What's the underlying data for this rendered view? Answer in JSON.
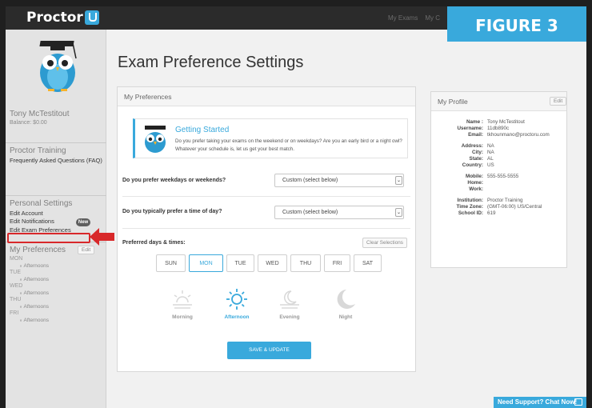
{
  "header": {
    "logo_text": "Proctor",
    "nav": [
      "My Exams",
      "My C"
    ]
  },
  "figure_label": "FIGURE 3",
  "user": {
    "name": "Tony McTestitout",
    "balance": "Balance: $0.00"
  },
  "sidebar": {
    "training": {
      "heading": "Proctor Training",
      "faq": "Frequently Asked Questions (FAQ)"
    },
    "settings": {
      "heading": "Personal Settings",
      "edit_account": "Edit Account",
      "edit_notifications": "Edit Notifications",
      "new_badge": "New",
      "edit_exam_prefs": "Edit Exam Preferences"
    },
    "my_prefs": {
      "heading": "My Preferences",
      "edit": "Edit",
      "items": [
        {
          "day": "MON",
          "time": "Afternoons"
        },
        {
          "day": "TUE",
          "time": "Afternoons"
        },
        {
          "day": "WED",
          "time": "Afternoons"
        },
        {
          "day": "THU",
          "time": "Afternoons"
        },
        {
          "day": "FRI",
          "time": "Afternoons"
        }
      ]
    }
  },
  "page_title": "Exam Preference Settings",
  "prefs": {
    "panel_title": "My Preferences",
    "gs_title": "Getting Started",
    "gs_desc": "Do you prefer taking your exams on the weekend or on weekdays? Are you an early bird or a night owl? Whatever your schedule is, let us get your best match.",
    "q1": "Do you prefer weekdays or weekends?",
    "q1_value": "Custom (select below)",
    "q2": "Do you typically prefer a time of day?",
    "q2_value": "Custom (select below)",
    "pref_label": "Preferred days & times:",
    "clear": "Clear Selections",
    "days": [
      "SUN",
      "MON",
      "TUE",
      "WED",
      "THU",
      "FRI",
      "SAT"
    ],
    "selected_day": "MON",
    "times": [
      "Morning",
      "Afternoon",
      "Evening",
      "Night"
    ],
    "selected_time": "Afternoon",
    "save": "SAVE & UPDATE"
  },
  "profile": {
    "title": "My Profile",
    "edit": "Edit",
    "rows": [
      {
        "k": "Name :",
        "v": "Tony McTestitout"
      },
      {
        "k": "Username:",
        "v": "11db890c"
      },
      {
        "k": "Email:",
        "v": "tkhounmano@proctoru.com"
      },
      {
        "k": "",
        "v": ""
      },
      {
        "k": "Address:",
        "v": "NA"
      },
      {
        "k": "City:",
        "v": "NA"
      },
      {
        "k": "State:",
        "v": "AL"
      },
      {
        "k": "Country:",
        "v": "US"
      },
      {
        "k": "",
        "v": ""
      },
      {
        "k": "Mobile:",
        "v": "555-555-5555"
      },
      {
        "k": "Home:",
        "v": ""
      },
      {
        "k": "Work:",
        "v": ""
      },
      {
        "k": "",
        "v": ""
      },
      {
        "k": "Institution:",
        "v": "Proctor Training"
      },
      {
        "k": "Time Zone:",
        "v": "(GMT-06:00) US/Central"
      },
      {
        "k": "School ID:",
        "v": "619"
      }
    ]
  },
  "chat": "Need Support? Chat Now!",
  "colors": {
    "accent": "#39a9dc",
    "highlight": "#d8282a"
  }
}
